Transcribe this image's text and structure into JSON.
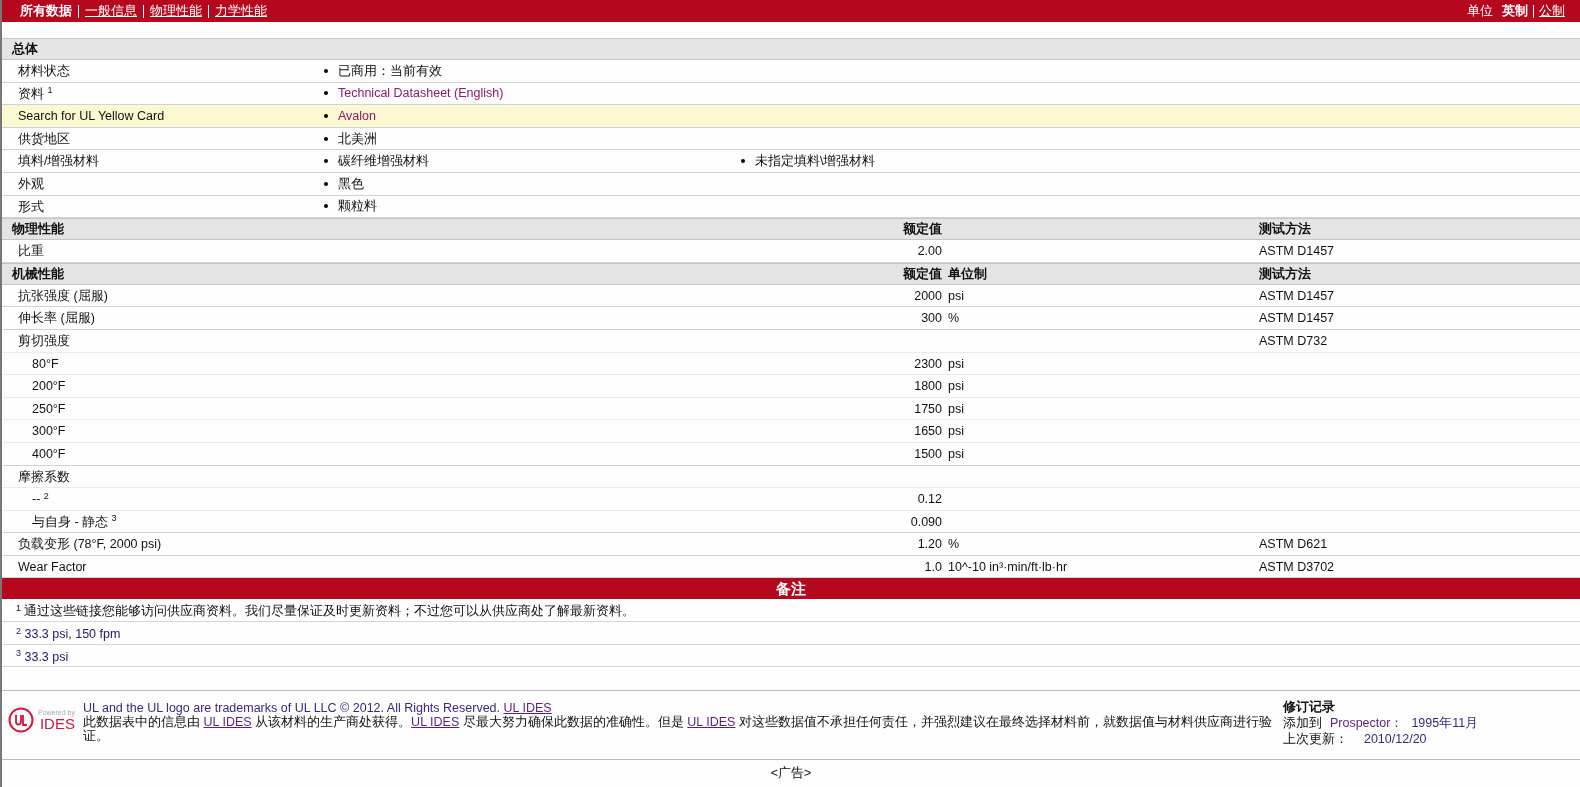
{
  "top_nav": {
    "tabs": [
      {
        "label": "所有数据",
        "selected": true
      },
      {
        "label": "一般信息",
        "selected": false
      },
      {
        "label": "物理性能",
        "selected": false
      },
      {
        "label": "力学性能",
        "selected": false
      }
    ],
    "units": {
      "label": "单位",
      "options": [
        {
          "label": "英制",
          "selected": true
        },
        {
          "label": "公制",
          "selected": false
        }
      ]
    }
  },
  "general": {
    "title": "总体",
    "rows": [
      {
        "label": "材料状态",
        "highlighted": false,
        "values": [
          {
            "text": "已商用：当前有效",
            "link": false
          }
        ]
      },
      {
        "label": "资料 $^{1}$",
        "highlighted": false,
        "values": [
          {
            "text": "Technical Datasheet (English)",
            "link": true
          }
        ]
      },
      {
        "label": "Search for UL Yellow Card",
        "highlighted": true,
        "values": [
          {
            "text": "Avalon",
            "link": true
          }
        ]
      },
      {
        "label": "供货地区",
        "highlighted": false,
        "values": [
          {
            "text": "北美洲",
            "link": false
          }
        ]
      },
      {
        "label": "填料/增强材料",
        "highlighted": false,
        "values": [
          {
            "text": "碳纤维增强材料",
            "link": false
          },
          {
            "text": "未指定填料\\增强材料",
            "link": false
          }
        ]
      },
      {
        "label": "外观",
        "highlighted": false,
        "values": [
          {
            "text": "黑色",
            "link": false
          }
        ]
      },
      {
        "label": "形式",
        "highlighted": false,
        "values": [
          {
            "text": "颗粒料",
            "link": false
          }
        ]
      }
    ]
  },
  "physical": {
    "title": "物理性能",
    "columns": [
      {
        "kind": "value",
        "label": "额定值"
      },
      {
        "kind": "method",
        "label": "测试方法"
      }
    ],
    "rows": [
      {
        "label": "比重",
        "value": "2.00",
        "method": "ASTM D1457"
      }
    ]
  },
  "mechanical": {
    "title": "机械性能",
    "columns": [
      {
        "kind": "value",
        "label": "额定值"
      },
      {
        "kind": "unit",
        "label": "单位制"
      },
      {
        "kind": "method",
        "label": "测试方法"
      }
    ],
    "rows": [
      {
        "label": "抗张强度 (屈服)",
        "value": "2000",
        "unit": "psi",
        "method": "ASTM D1457"
      },
      {
        "label": "伸长率 (屈服)",
        "value": "300",
        "unit": "%",
        "method": "ASTM D1457"
      },
      {
        "label": "剪切强度",
        "method": "ASTM D732",
        "children": [
          {
            "label": "80°F",
            "value": "2300",
            "unit": "psi"
          },
          {
            "label": "200°F",
            "value": "1800",
            "unit": "psi"
          },
          {
            "label": "250°F",
            "value": "1750",
            "unit": "psi"
          },
          {
            "label": "300°F",
            "value": "1650",
            "unit": "psi"
          },
          {
            "label": "400°F",
            "value": "1500",
            "unit": "psi"
          }
        ]
      },
      {
        "label": "摩擦系数",
        "children": [
          {
            "label": "-- $^{2}$",
            "value": "0.12"
          },
          {
            "label": "与自身 - 静态 $^{3}$",
            "value": "0.090"
          }
        ]
      },
      {
        "label": "负载变形 (78°F, 2000 psi)",
        "value": "1.20",
        "unit": "%",
        "method": "ASTM D621"
      },
      {
        "label": "Wear Factor",
        "value": "1.0",
        "unit": "10^-10 in³·min/ft·lb·hr",
        "method": "ASTM D3702"
      }
    ]
  },
  "notes": {
    "title": "备注",
    "items": [
      "$^{1}$ 通过这些链接您能够访问供应商资料。我们尽量保证及时更新资料；不过您可以从供应商处了解最新资料。",
      "$^{2}$ 33.3 psi, 150 fpm",
      "$^{3}$ 33.3 psi"
    ]
  },
  "footer": {
    "logo": {
      "powered_by": "Powered by",
      "name": "IDES"
    },
    "trademark": [
      {
        "text": "UL and the UL logo are trademarks of UL LLC © 2012. All Rights Reserved. ",
        "link": false
      },
      {
        "text": "UL IDES",
        "link": true
      }
    ],
    "disclaimer": [
      {
        "text": "此数据表中的信息由 ",
        "link": false
      },
      {
        "text": "UL IDES",
        "link": true
      },
      {
        "text": " 从该材料的生产商处获得。",
        "link": false
      },
      {
        "text": "UL IDES",
        "link": true
      },
      {
        "text": " 尽最大努力确保此数据的准确性。但是 ",
        "link": false
      },
      {
        "text": "UL IDES",
        "link": true
      },
      {
        "text": " 对这些数据值不承担任何责任，并强烈建议在最终选择材料前，就数据值与材料供应商进行验证。",
        "link": false
      }
    ],
    "revision": {
      "title": "修订记录",
      "added_label": "添加到",
      "added_link": "Prospector：",
      "added_date": "1995年11月",
      "updated_label": "上次更新：",
      "updated_date": "2010/12/20"
    }
  },
  "ad": "<广告>"
}
